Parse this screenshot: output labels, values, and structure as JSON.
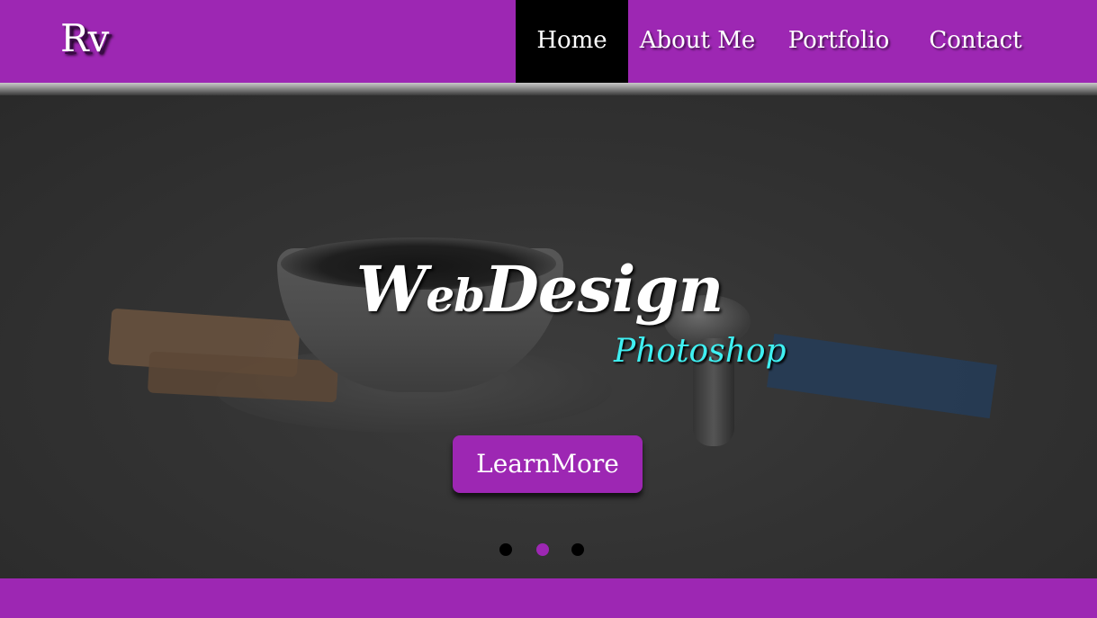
{
  "header": {
    "logo_text": "Rv",
    "nav": [
      {
        "label": "Home",
        "active": true
      },
      {
        "label": "About Me",
        "active": false
      },
      {
        "label": "Portfolio",
        "active": false
      },
      {
        "label": "Contact",
        "active": false
      }
    ]
  },
  "hero": {
    "title_part1": "W",
    "title_part2": "eb",
    "title_part3": "Design",
    "subtitle": "Photoshop",
    "button_label": "LearnMore",
    "carousel_active_index": 1,
    "carousel_count": 3
  },
  "colors": {
    "brand_purple": "#9d27b3",
    "subtitle_cyan": "#3ff0f2",
    "nav_active_bg": "#000000"
  }
}
